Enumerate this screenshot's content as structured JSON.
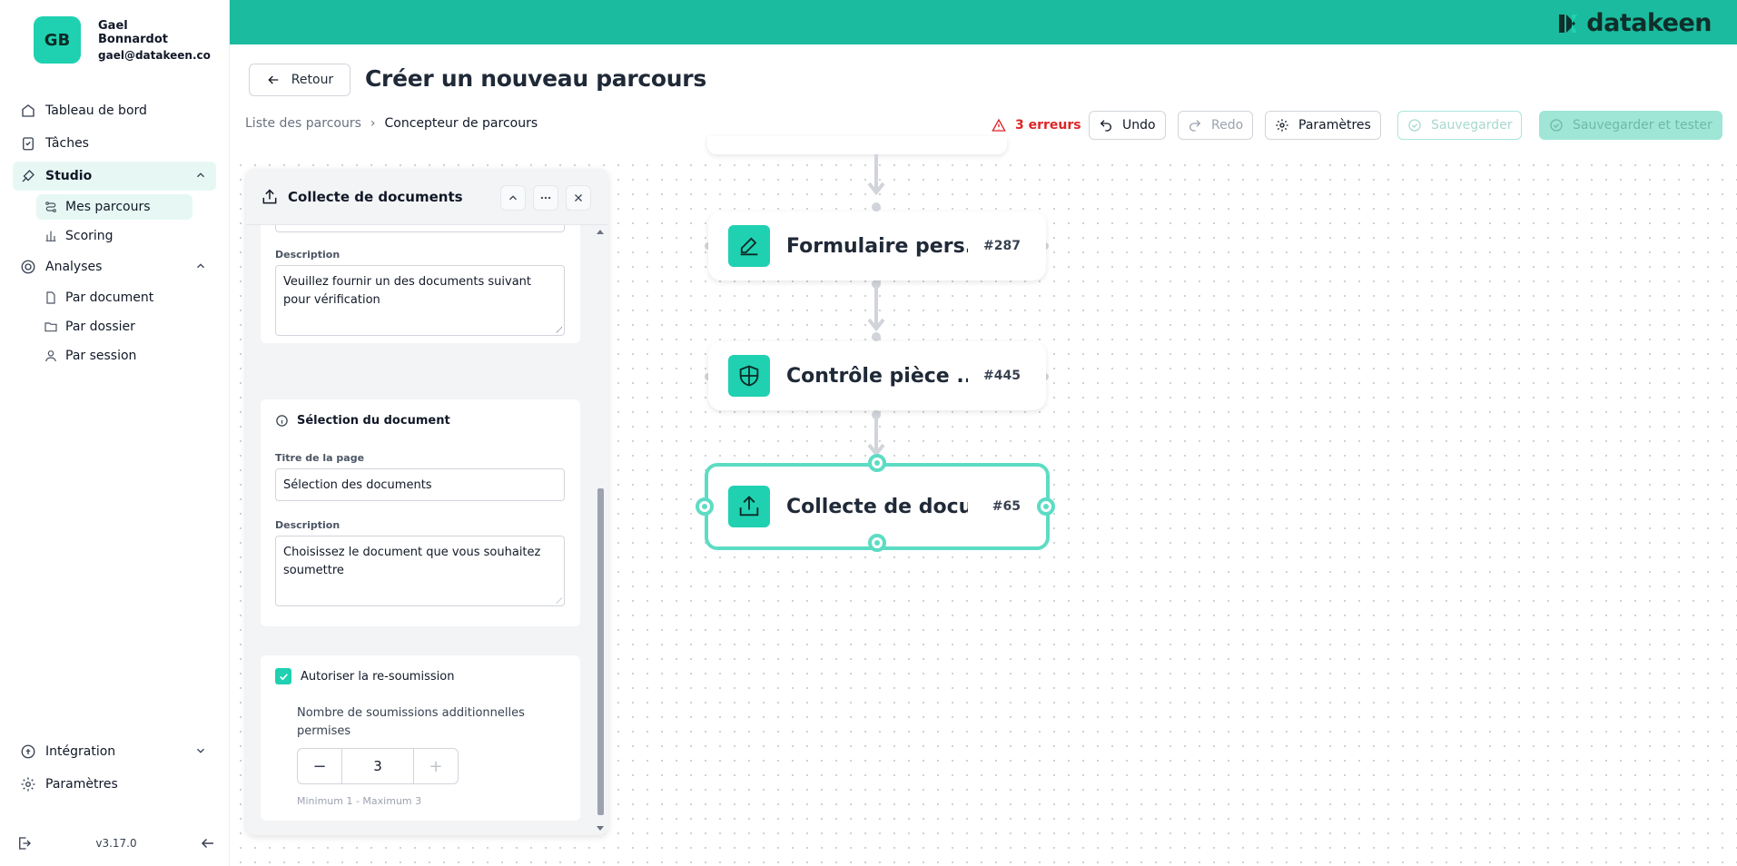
{
  "user": {
    "initials": "GB",
    "name": "Gael Bonnardot",
    "email": "gael@datakeen.co"
  },
  "nav": {
    "dashboard": "Tableau de bord",
    "tasks": "Tâches",
    "studio": "Studio",
    "my_journeys": "Mes parcours",
    "scoring": "Scoring",
    "analyses": "Analyses",
    "by_document": "Par document",
    "by_folder": "Par dossier",
    "by_session": "Par session",
    "integration": "Intégration",
    "settings": "Paramètres"
  },
  "footer": {
    "version": "v3.17.0"
  },
  "brand": {
    "name": "datakeen",
    "accent": "#1bbb9f"
  },
  "header": {
    "back_label": "Retour",
    "title": "Créer un nouveau parcours",
    "breadcrumb": [
      "Liste des parcours",
      "Concepteur de parcours"
    ],
    "errors": "3 erreurs",
    "undo": "Undo",
    "redo": "Redo",
    "params": "Paramètres",
    "save": "Sauvegarder",
    "save_test": "Sauvegarder et tester"
  },
  "nodes": [
    {
      "label": "Formulaire pers...",
      "id": "#287",
      "icon": "pencil-icon"
    },
    {
      "label": "Contrôle pièce ...",
      "id": "#445",
      "icon": "shield-icon"
    },
    {
      "label": "Collecte de docu...",
      "id": "#65",
      "icon": "upload-icon"
    }
  ],
  "panel": {
    "title": "Collecte de documents",
    "description_label": "Description",
    "description_value": "Veuillez fournir un des documents suivant pour vérification",
    "doc_section_title": "Sélection du document",
    "page_title_label": "Titre de la page",
    "page_title_value": "Sélection des documents",
    "doc_description_label": "Description",
    "doc_description_value": "Choisissez le document que vous souhaitez soumettre",
    "resubmit_label": "Autoriser la re-soumission",
    "extra_submissions_label": "Nombre de soumissions additionnelles permises",
    "stepper_value": "3",
    "stepper_hint": "Minimum 1 - Maximum 3"
  }
}
